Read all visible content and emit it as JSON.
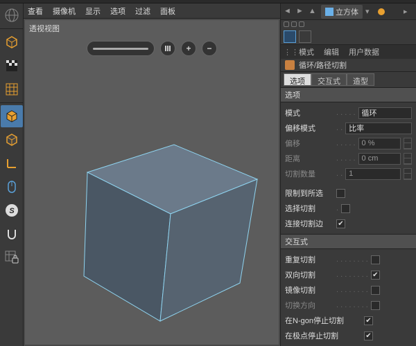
{
  "menubar": {
    "view": "查看",
    "camera": "摄像机",
    "display": "显示",
    "options": "选项",
    "filter": "过滤",
    "panel": "面板"
  },
  "viewport": {
    "label": "透视视图"
  },
  "breadcrumb": {
    "object": "立方体"
  },
  "modeTabs": {
    "mode": "模式",
    "edit": "编辑",
    "userdata": "用户数据"
  },
  "tool": {
    "name": "循环/路径切割"
  },
  "subTabs": {
    "options": "选项",
    "interactive": "交互式",
    "shaping": "造型"
  },
  "sections": {
    "options": "选项",
    "interactive": "交互式"
  },
  "props": {
    "mode": {
      "label": "模式",
      "value": "循环"
    },
    "offsetMode": {
      "label": "偏移模式",
      "value": "比率"
    },
    "offset": {
      "label": "偏移",
      "value": "0 %"
    },
    "distance": {
      "label": "距离",
      "value": "0 cm"
    },
    "cutCount": {
      "label": "切割数量",
      "value": "1"
    },
    "limitSel": {
      "label": "限制到所选",
      "checked": false
    },
    "selectCut": {
      "label": "选择切割",
      "checked": false
    },
    "connectEdges": {
      "label": "连接切割边",
      "checked": true
    },
    "repeatCut": {
      "label": "重复切割",
      "checked": false
    },
    "bidirCut": {
      "label": "双向切割",
      "checked": true
    },
    "mirrorCut": {
      "label": "镜像切割",
      "checked": false
    },
    "switchDir": {
      "label": "切换方向",
      "checked": false
    },
    "stopNgon": {
      "label": "在N-gon停止切割",
      "checked": true
    },
    "stopPole": {
      "label": "在极点停止切割",
      "checked": true
    }
  },
  "icons": {
    "globe": "globe-icon",
    "cube": "cube-icon",
    "pattern": "pattern-icon",
    "grid": "grid-icon",
    "cubeSolid": "cube-solid-icon",
    "cubeOutline": "cube-outline-icon",
    "axis": "axis-icon",
    "mouse": "mouse-icon",
    "s": "s-icon",
    "magnet": "magnet-icon",
    "gridLock": "grid-lock-icon"
  }
}
